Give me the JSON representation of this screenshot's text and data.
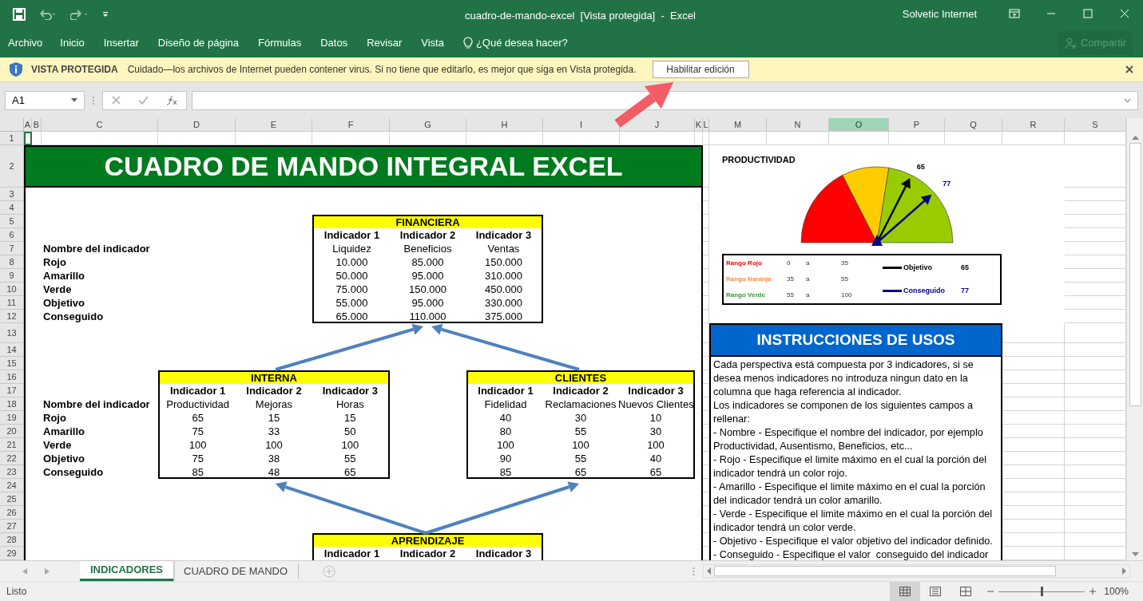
{
  "window": {
    "title": "cuadro-de-mando-excel  [Vista protegida]  -  Excel",
    "user": "Solvetic Internet"
  },
  "ribbon_tabs": [
    "Archivo",
    "Inicio",
    "Insertar",
    "Diseño de página",
    "Fórmulas",
    "Datos",
    "Revisar",
    "Vista"
  ],
  "tell_me": "¿Qué desea hacer?",
  "share_button": "Compartir",
  "protected_bar": {
    "title": "VISTA PROTEGIDA",
    "message": "Cuidado—los archivos de Internet pueden contener virus. Si no tiene que editarlo, es mejor que siga en Vista protegida.",
    "button": "Habilitar edición"
  },
  "formula_bar": {
    "name_box": "A1"
  },
  "column_headers": [
    {
      "label": "A",
      "selected": false
    },
    {
      "label": "B",
      "selected": false
    },
    {
      "label": "C",
      "selected": false
    },
    {
      "label": "D",
      "selected": false
    },
    {
      "label": "E",
      "selected": false
    },
    {
      "label": "F",
      "selected": false
    },
    {
      "label": "G",
      "selected": false
    },
    {
      "label": "H",
      "selected": false
    },
    {
      "label": "I",
      "selected": false
    },
    {
      "label": "J",
      "selected": false
    },
    {
      "label": "K",
      "selected": false
    },
    {
      "label": "L",
      "selected": false
    },
    {
      "label": "M",
      "selected": false
    },
    {
      "label": "N",
      "selected": false
    },
    {
      "label": "O",
      "selected": true
    },
    {
      "label": "P",
      "selected": false
    },
    {
      "label": "Q",
      "selected": false
    },
    {
      "label": "R",
      "selected": false
    },
    {
      "label": "S",
      "selected": false
    }
  ],
  "row_headers": [
    "1",
    "2",
    "3",
    "4",
    "5",
    "6",
    "7",
    "8",
    "9",
    "10",
    "11",
    "12",
    "13",
    "14",
    "15",
    "16",
    "17",
    "18",
    "19",
    "20",
    "21",
    "22",
    "23",
    "24",
    "25",
    "26",
    "27",
    "28",
    "29"
  ],
  "dashboard": {
    "title": "CUADRO DE MANDO INTEGRAL EXCEL",
    "label_groups": [
      {
        "labels": [
          "Nombre del indicador",
          "Rojo",
          "Amarillo",
          "Verde",
          "Objetivo",
          "Conseguido"
        ]
      },
      {
        "labels": [
          "Nombre del indicador",
          "Rojo",
          "Amarillo",
          "Verde",
          "Objetivo",
          "Conseguido"
        ]
      }
    ],
    "tables": [
      {
        "title": "FINANCIERA",
        "headers": [
          "Indicador 1",
          "Indicador 2",
          "Indicador 3"
        ],
        "names": [
          "Liquidez",
          "Beneficios",
          "Ventas"
        ],
        "rows": [
          [
            "10.000",
            "85.000",
            "150.000"
          ],
          [
            "50.000",
            "95.000",
            "310.000"
          ],
          [
            "75.000",
            "150.000",
            "450.000"
          ],
          [
            "55.000",
            "95.000",
            "330.000"
          ],
          [
            "65.000",
            "110.000",
            "375.000"
          ]
        ]
      },
      {
        "title": "INTERNA",
        "headers": [
          "Indicador 1",
          "Indicador 2",
          "Indicador 3"
        ],
        "names": [
          "Productividad",
          "Mejoras",
          "Horas"
        ],
        "rows": [
          [
            "65",
            "15",
            "15"
          ],
          [
            "75",
            "33",
            "50"
          ],
          [
            "100",
            "100",
            "100"
          ],
          [
            "75",
            "38",
            "55"
          ],
          [
            "85",
            "48",
            "65"
          ]
        ]
      },
      {
        "title": "CLIENTES",
        "headers": [
          "Indicador 1",
          "Indicador 2",
          "Indicador 3"
        ],
        "names": [
          "Fidelidad",
          "Reclamaciones",
          "Nuevos Clientes"
        ],
        "rows": [
          [
            "40",
            "30",
            "10"
          ],
          [
            "80",
            "55",
            "30"
          ],
          [
            "100",
            "100",
            "100"
          ],
          [
            "90",
            "55",
            "40"
          ],
          [
            "85",
            "65",
            "65"
          ]
        ]
      },
      {
        "title": "APRENDIZAJE",
        "headers": [
          "Indicador 1",
          "Indicador 2",
          "Indicador 3"
        ]
      }
    ]
  },
  "gauge": {
    "title": "PRODUCTIVIDAD",
    "ranges": [
      {
        "label": "Rango Rojo",
        "from": "0",
        "sep": "a",
        "to": "35",
        "color": "#ff0000"
      },
      {
        "label": "Rango Naranja",
        "from": "35",
        "sep": "a",
        "to": "55",
        "color": "#ffcc00"
      },
      {
        "label": "Rango Verde",
        "from": "55",
        "sep": "a",
        "to": "100",
        "color": "#99cc00"
      }
    ],
    "objective": {
      "marker": "65",
      "label": "Objetivo",
      "value": "65"
    },
    "achieved": {
      "marker": "77",
      "label": "Conseguido",
      "value": "77"
    }
  },
  "instructions": {
    "title": "INSTRUCCIONES DE USOS",
    "paragraphs": [
      "Cada perspectiva está compuesta por 3 indicadores, si se desea menos indicadores no introduza ningun dato en la columna que haga referencia al indicador.",
      "Los indicadores se componen de los siguientes campos a rellenar:",
      "- Nombre - Especifique el nombre del indicador, por ejemplo Productividad, Ausentismo, Beneficios, etc...",
      "- Rojo - Especifique el limite máximo en el cual la porción del indicador tendrá un color rojo.",
      "- Amarillo - Especifique el limite máximo en el cual la porción del indicador tendrá un color amarillo.",
      "- Verde - Especifique el limite máximo en el cual la porción del indicador tendrá un color verde.",
      "- Objetivo - Especifique el valor objetivo del indicador definido.",
      "- Conseguido - Especifique el valor  conseguido del indicador"
    ]
  },
  "sheet_tabs": [
    {
      "label": "INDICADORES",
      "selected": true
    },
    {
      "label": "CUADRO DE MANDO",
      "selected": false
    }
  ],
  "status_bar": {
    "text": "Listo",
    "zoom_slider": {
      "level": 0.5
    },
    "zoom": "100%"
  }
}
